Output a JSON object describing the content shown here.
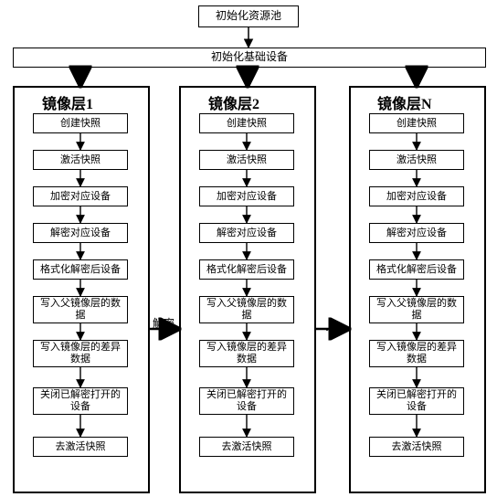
{
  "top": {
    "init_pool": "初始化资源池",
    "init_base": "初始化基础设备"
  },
  "columns": [
    {
      "title": "镜像层1"
    },
    {
      "title": "镜像层2"
    },
    {
      "title": "镜像层N"
    }
  ],
  "steps": {
    "s1": "创建快照",
    "s2": "激活快照",
    "s3": "加密对应设备",
    "s4": "解密对应设备",
    "s5": "格式化解密后设备",
    "s6": "写入父镜像层的数据",
    "s7": "写入镜像层的差异数据",
    "s8": "关闭已解密打开的设备",
    "s9": "去激活快照"
  },
  "mid_label": "解密",
  "ellipsis": "…"
}
